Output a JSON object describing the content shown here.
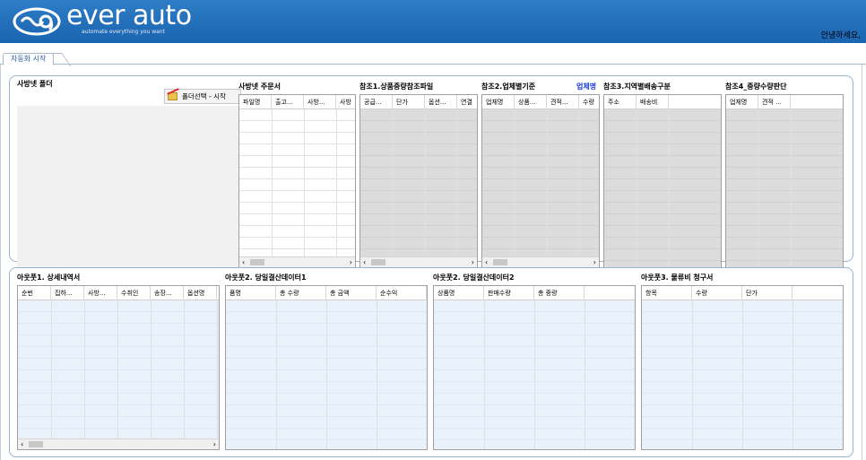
{
  "header": {
    "brand": "ever auto",
    "tagline": "automate everything you want",
    "greeting": "안녕하세요,",
    "colors": {
      "bar": "#1e6ab5",
      "accent": "#1c3fd6"
    }
  },
  "tabs": [
    {
      "label": "자동화 시작",
      "active": true
    }
  ],
  "top": {
    "folder_title": "사방넷 폴더",
    "folder_button": "폴더선택 - 시작",
    "folder_icon": "folder-icon",
    "panels": [
      {
        "title": "사방넷 주문서",
        "columns": [
          "파일명",
          "출고...",
          "사방...",
          "사방"
        ],
        "style": "white",
        "scroll": true
      },
      {
        "title": "참조1.상품중량참조파일",
        "columns": [
          "공급...",
          "단가",
          "옵션...",
          "연결"
        ],
        "style": "gray",
        "scroll": true
      },
      {
        "title": "참조2.업체별기준",
        "extra": "업체명",
        "columns": [
          "업체명",
          "상품...",
          "견적...",
          "수량"
        ],
        "style": "gray",
        "scroll": true
      },
      {
        "title": "참조3.지역별배송구분",
        "columns": [
          "주소",
          "배송비"
        ],
        "style": "gray",
        "scroll": false
      },
      {
        "title": "참조4_중량수량판단",
        "columns": [
          "업체명",
          "견적 ..."
        ],
        "style": "gray",
        "scroll": false
      }
    ]
  },
  "bottom": {
    "panels": [
      {
        "title": "아웃풋1. 상세내역서",
        "columns": [
          "순번",
          "집하...",
          "사방...",
          "수취인",
          "송장...",
          "옵션명"
        ],
        "scroll": true
      },
      {
        "title": "아웃풋2. 당일결산데이터1",
        "columns": [
          "품명",
          "총 수량",
          "총 금액",
          "순수익"
        ],
        "scroll": false
      },
      {
        "title": "아웃풋2. 당일결산데이터2",
        "columns": [
          "상품명",
          "판매수량",
          "총 중량"
        ],
        "scroll": false
      },
      {
        "title": "아웃풋3. 물류비 청구서",
        "columns": [
          "항목",
          "수량",
          "단가"
        ],
        "scroll": false
      }
    ]
  }
}
